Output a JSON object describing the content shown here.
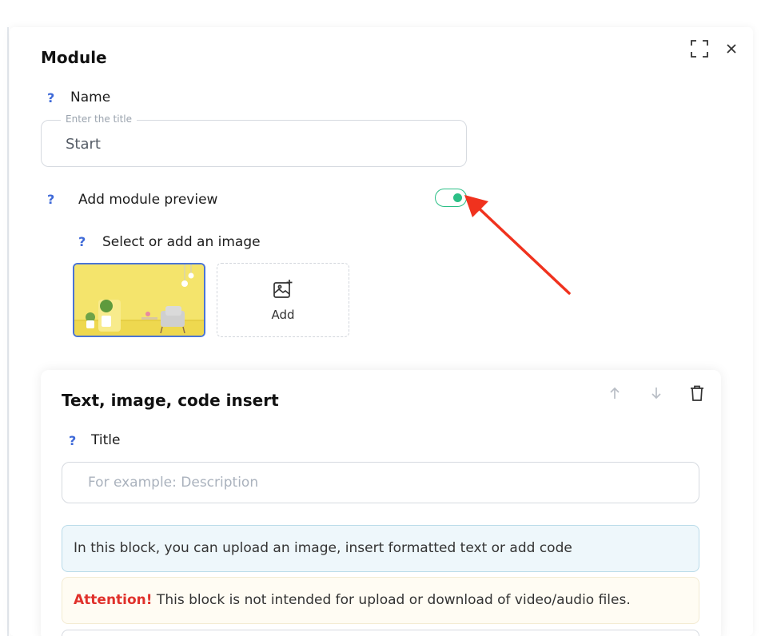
{
  "modal": {
    "title": "Module",
    "name_hint": "?",
    "name_label": "Name",
    "name_field_label": "Enter the title",
    "name_value": "Start",
    "preview_hint": "?",
    "preview_label": "Add module preview",
    "preview_enabled": true,
    "image_hint": "?",
    "image_label": "Select or add an image",
    "add_label": "Add",
    "icons": {
      "fullscreen": "expand-icon",
      "close": "close-icon",
      "add_image": "image-plus-icon"
    },
    "colors": {
      "toggle_accent": "#2bbf86",
      "selected_border": "#4a74d6",
      "annotation_arrow": "#f0321e"
    }
  },
  "block": {
    "title": "Text, image, code insert",
    "title_hint": "?",
    "title_label": "Title",
    "title_placeholder": "For example: Description",
    "info_text": "In this block, you can upload an image, insert formatted text or add code",
    "warning_strong": "Attention!",
    "warning_text": " This block is not intended for upload or download of video/audio files.",
    "icons": {
      "move_up": "arrow-up-icon",
      "move_down": "arrow-down-icon",
      "delete": "trash-icon"
    }
  }
}
